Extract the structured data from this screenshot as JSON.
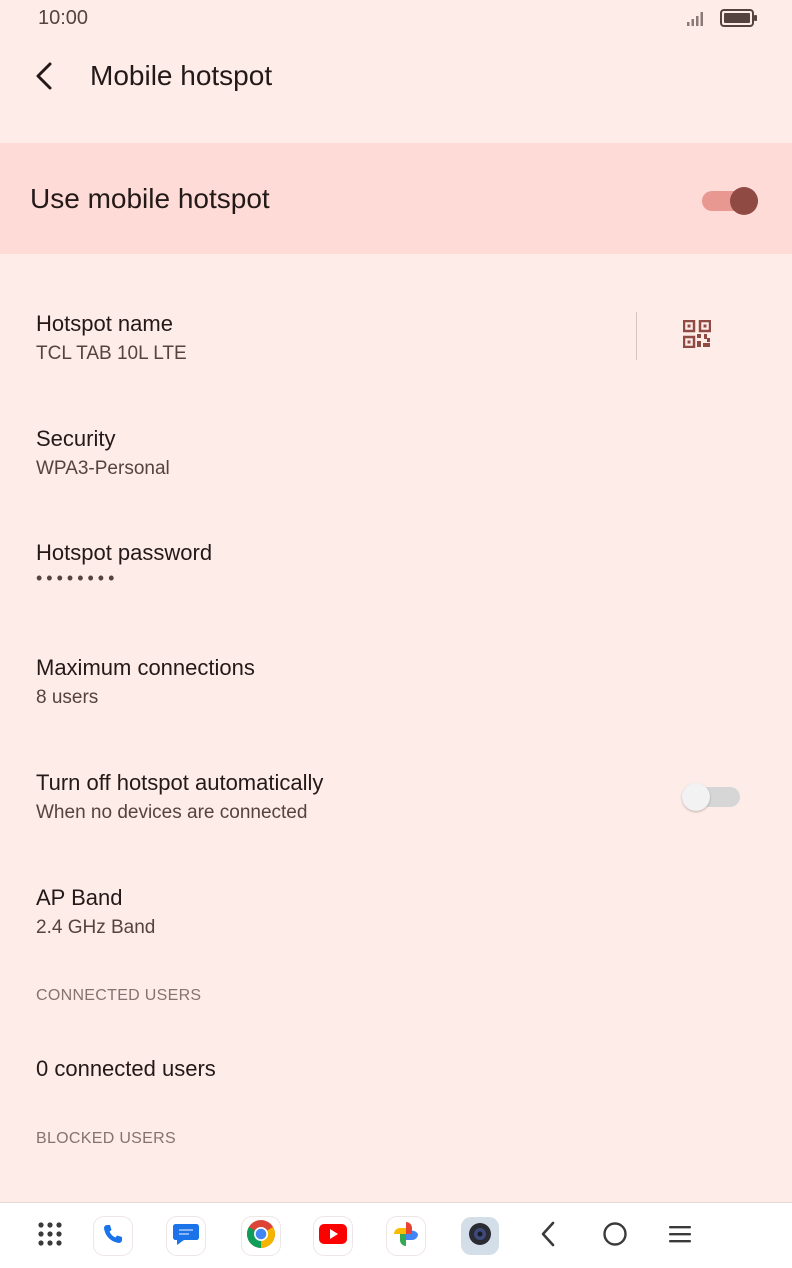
{
  "status_bar": {
    "time": "10:00"
  },
  "app_bar": {
    "title": "Mobile hotspot"
  },
  "master_switch": {
    "label": "Use mobile hotspot",
    "checked": true
  },
  "preferences": {
    "hotspot_name": {
      "title": "Hotspot name",
      "summary": "TCL TAB 10L LTE"
    },
    "security": {
      "title": "Security",
      "summary": "WPA3-Personal"
    },
    "password": {
      "title": "Hotspot password",
      "summary": "••••••••"
    },
    "max_connections": {
      "title": "Maximum connections",
      "summary": "8 users"
    },
    "auto_off": {
      "title": "Turn off hotspot automatically",
      "summary": "When no devices are connected",
      "checked": false
    },
    "ap_band": {
      "title": "AP Band",
      "summary": "2.4 GHz Band"
    }
  },
  "connected_users": {
    "header": "CONNECTED USERS",
    "count_text": "0 connected users"
  },
  "blocked_users": {
    "header": "BLOCKED USERS"
  },
  "nav_bar": {
    "items": [
      "app-drawer-icon",
      "phone-icon",
      "messages-icon",
      "chrome-icon",
      "youtube-icon",
      "photos-icon",
      "camera-icon",
      "back-icon",
      "home-icon",
      "recents-icon"
    ]
  },
  "colors": {
    "background": "#FEECE9",
    "highlight": "#FEDBD7",
    "accent": "#8F4A43",
    "accent_track": "#E89891"
  }
}
